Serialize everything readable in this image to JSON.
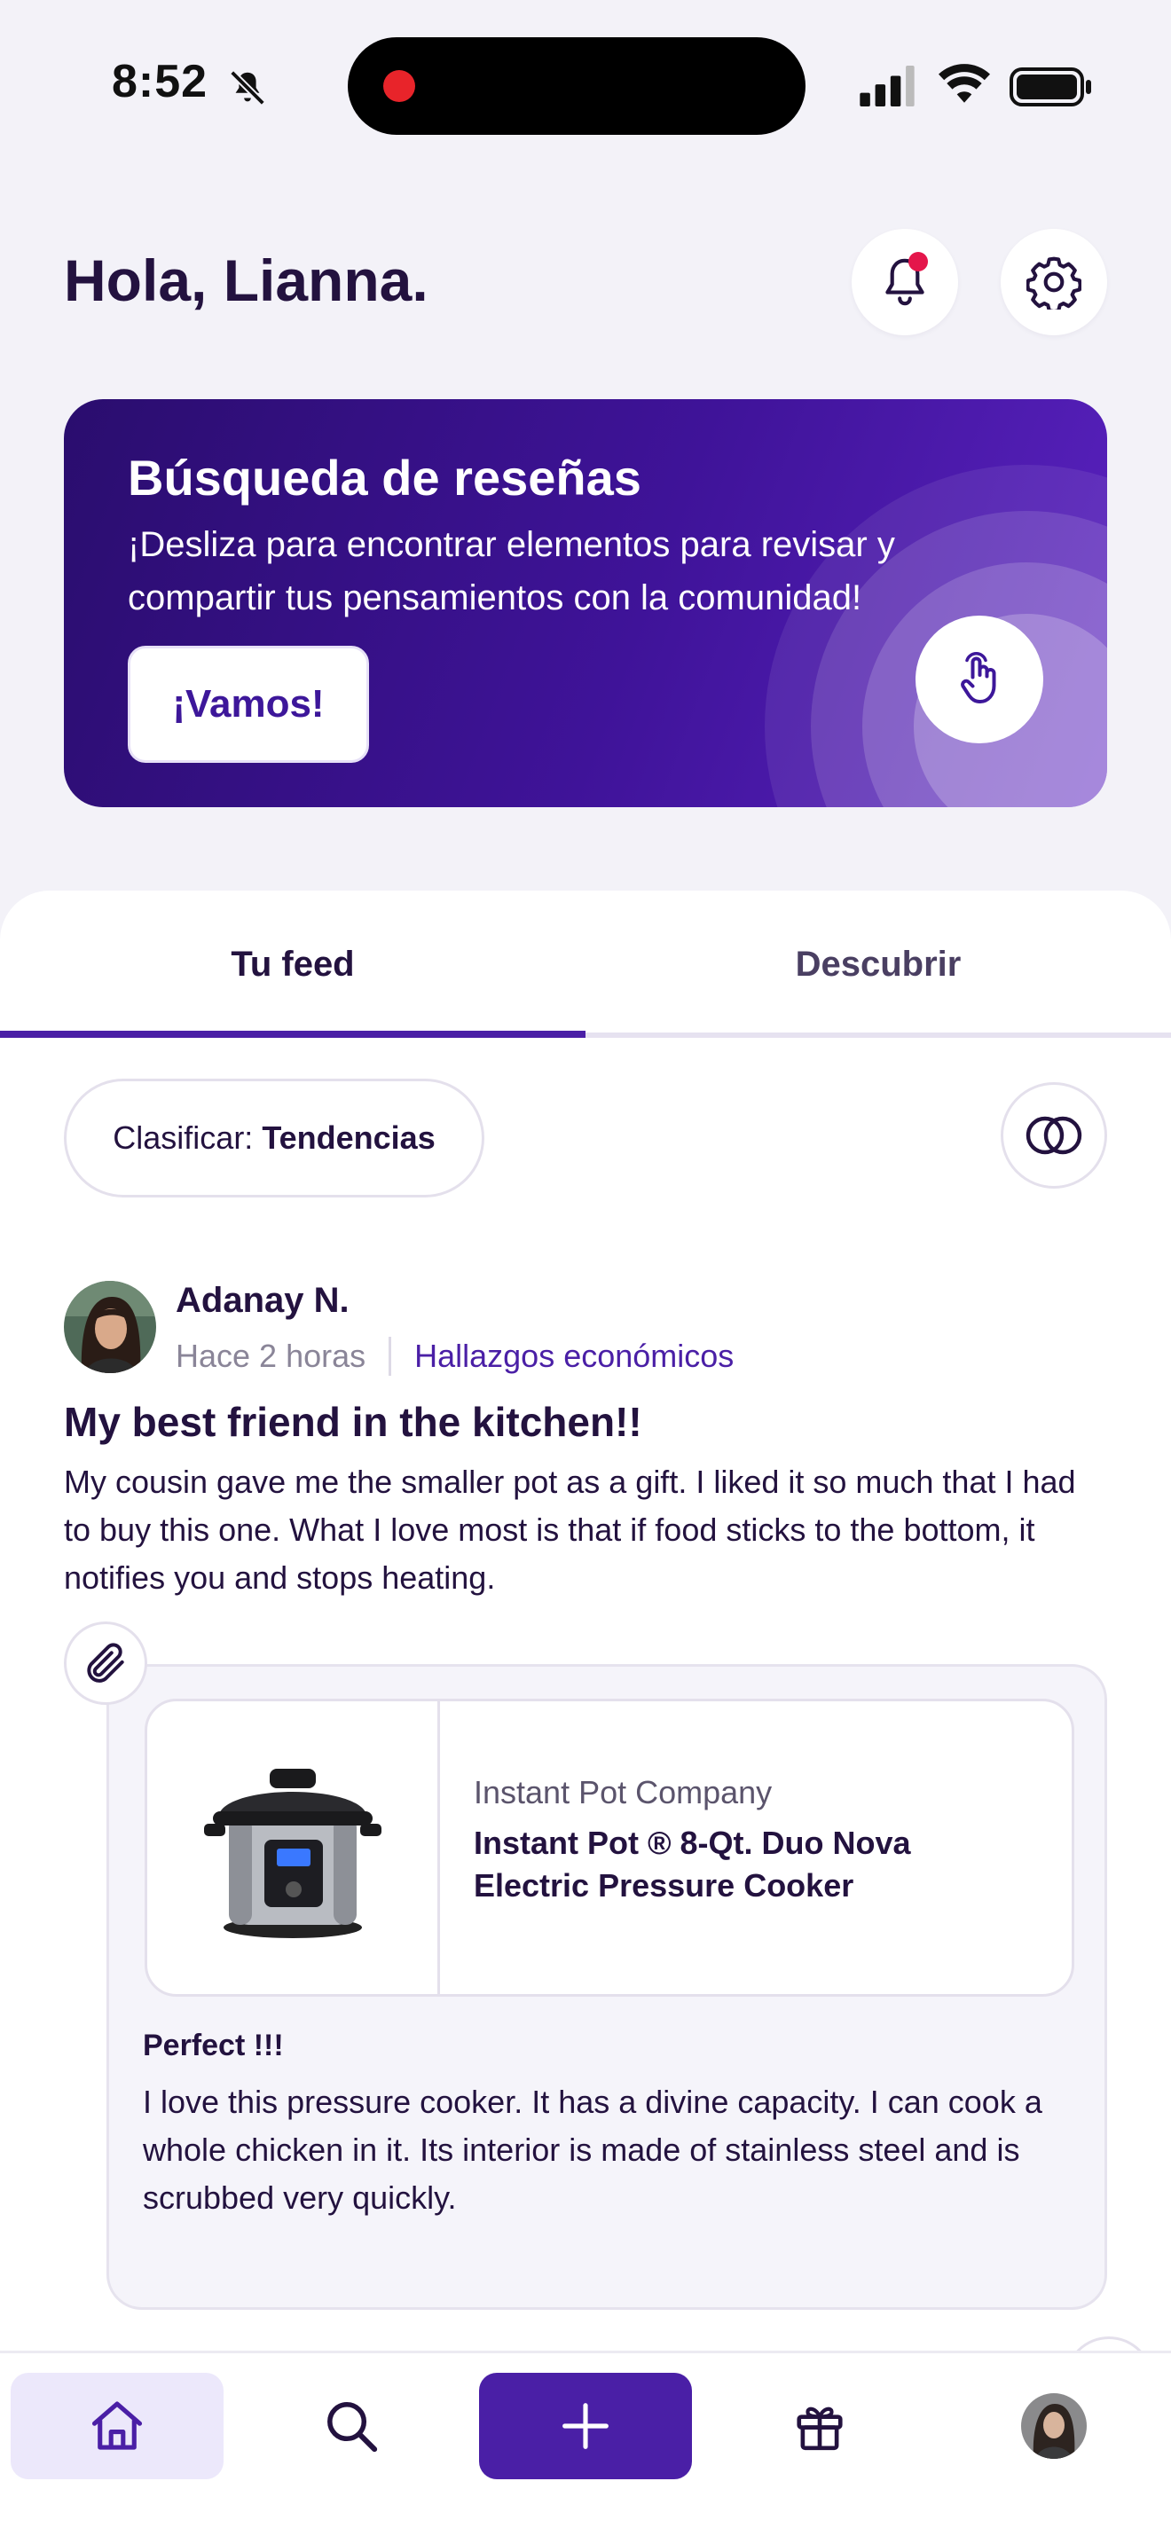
{
  "status_bar": {
    "time": "8:52",
    "icons": [
      "bell-slash-icon",
      "cellular-signal-icon",
      "wifi-icon",
      "battery-icon"
    ]
  },
  "header": {
    "greeting": "Hola, Lianna.",
    "notification_icon": "bell-icon",
    "settings_icon": "gear-icon",
    "has_unread_notifications": true
  },
  "promo": {
    "title": "Búsqueda de reseñas",
    "text": "¡Desliza para encontrar elementos para revisar y compartir tus pensamientos con la comunidad!",
    "cta_label": "¡Vamos!",
    "icon": "tap-hand-icon"
  },
  "tabs": [
    {
      "label": "Tu feed",
      "active": true
    },
    {
      "label": "Descubrir",
      "active": false
    }
  ],
  "sort": {
    "prefix": "Clasificar:",
    "value": "Tendencias"
  },
  "post": {
    "author": "Adanay N.",
    "time": "Hace 2 horas",
    "category": "Hallazgos económicos",
    "title": "My best friend in the kitchen!!",
    "body": "My cousin gave me the smaller pot as a gift. I liked it so much that I had to buy this one. What I love most is that if food sticks to the bottom, it notifies you and stops heating.",
    "product": {
      "brand": "Instant Pot Company",
      "name": "Instant Pot ® 8-Qt. Duo  Nova Electric Pressure Cooker"
    },
    "review": {
      "title": "Perfect !!!",
      "body": "I love this pressure cooker. It has a divine capacity. I can cook a whole chicken in it. Its interior is made of stainless steel and is scrubbed very quickly."
    }
  },
  "bottom_nav": {
    "items": [
      "home-icon",
      "search-icon",
      "plus-icon",
      "gift-icon",
      "profile-avatar"
    ],
    "active": "home-icon"
  },
  "colors": {
    "brand_purple": "#4a1fa6",
    "promo_gradient_start": "#2a0d6e",
    "text_dark": "#23123f",
    "notification_dot": "#e4164b"
  }
}
